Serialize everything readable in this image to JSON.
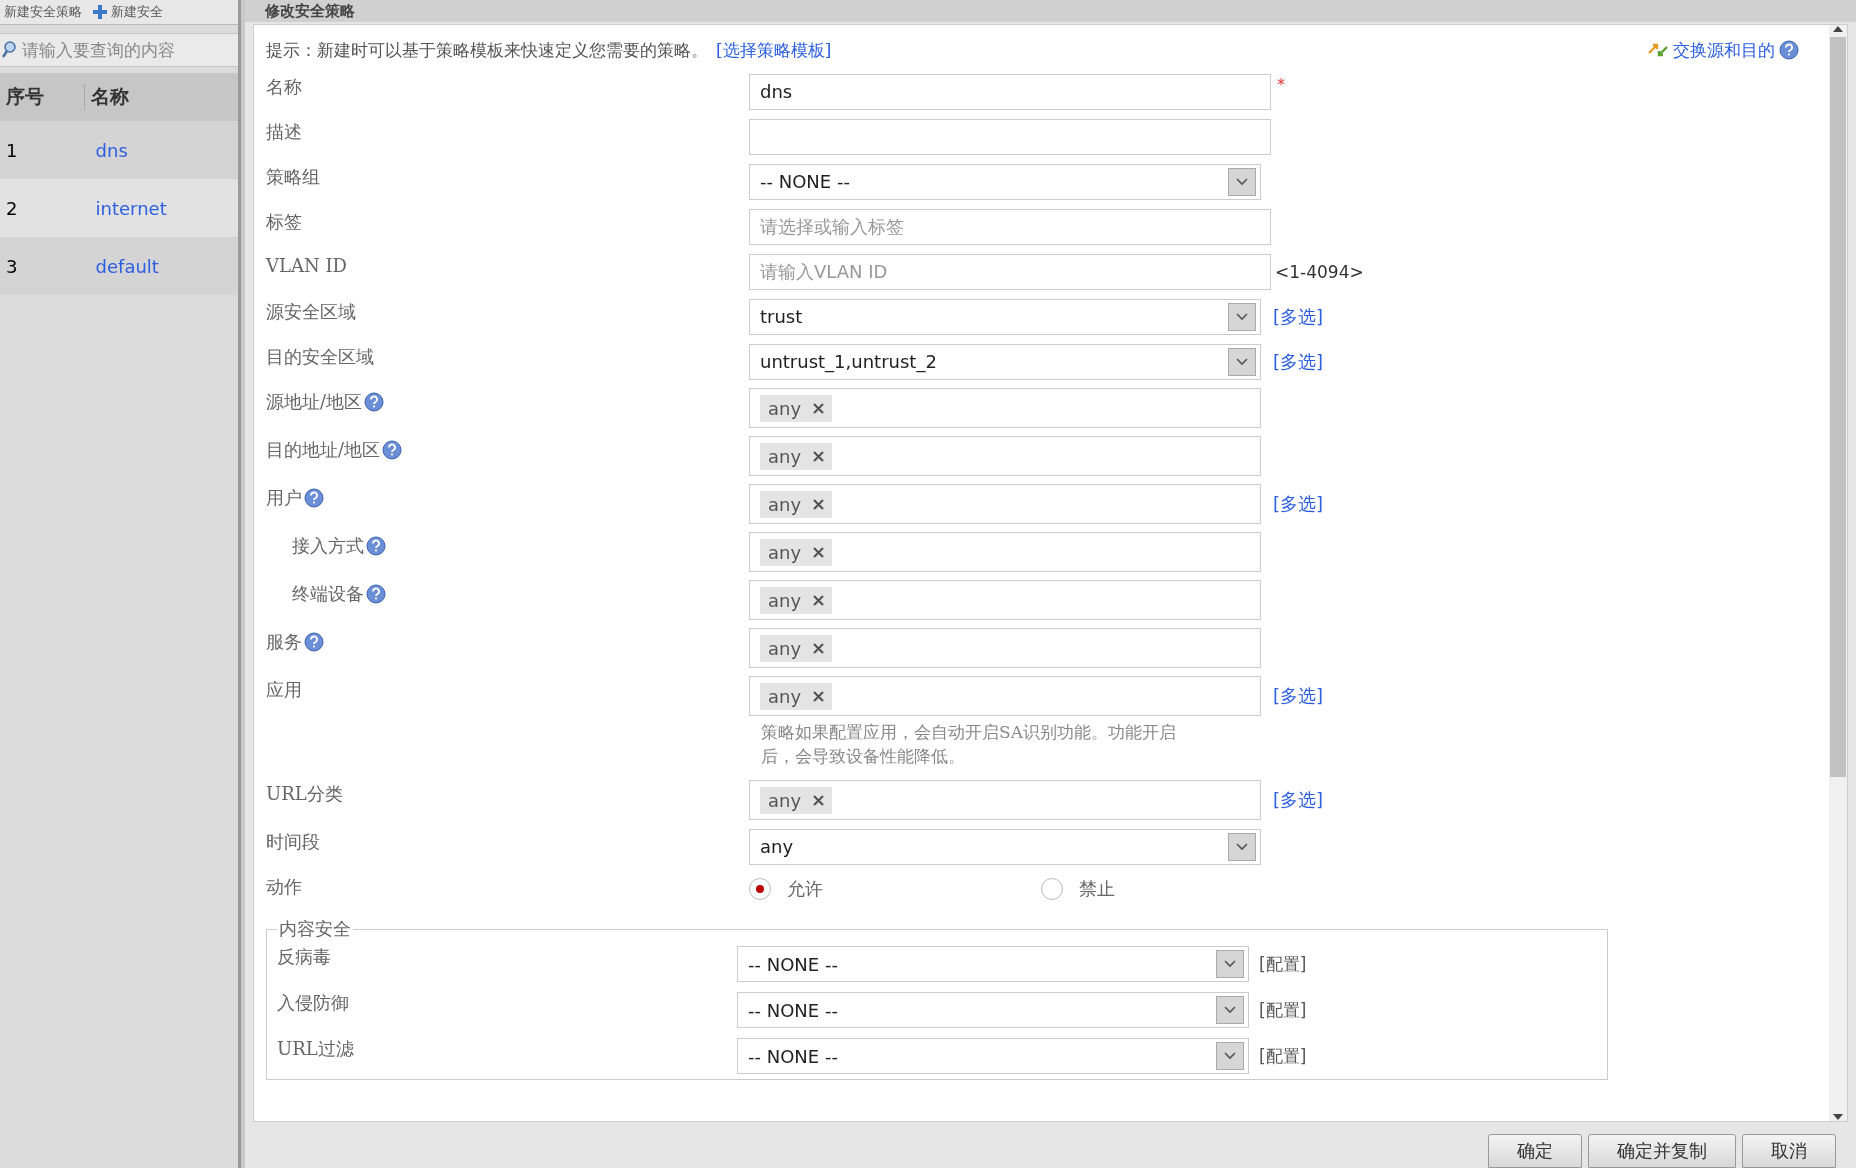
{
  "toolbar": {
    "buttons": [
      {
        "label": "新建安全策略",
        "icon": false
      },
      {
        "label": "新建安全",
        "icon": true
      }
    ]
  },
  "search": {
    "placeholder": "请输入要查询的内容"
  },
  "table": {
    "columns": [
      "序号",
      "名称"
    ],
    "rows": [
      {
        "index": "1",
        "name": "dns"
      },
      {
        "index": "2",
        "name": "internet"
      },
      {
        "index": "3",
        "name": "default"
      }
    ]
  },
  "dialog": {
    "title": "修改安全策略",
    "hint": {
      "text": "提示：新建时可以基于策略模板来快速定义您需要的策略。",
      "link": "[选择策略模板]"
    },
    "swap_link": "交换源和目的",
    "fields": [
      {
        "label": "名称",
        "kind": "text",
        "value": "dns",
        "required_mark": "*"
      },
      {
        "label": "描述",
        "kind": "text"
      },
      {
        "label": "策略组",
        "kind": "select",
        "value": "-- NONE --"
      },
      {
        "label": "标签",
        "kind": "text",
        "placeholder": "请选择或输入标签"
      },
      {
        "label": "VLAN ID",
        "kind": "text",
        "placeholder": "请输入VLAN ID",
        "suffix": "<1-4094>"
      },
      {
        "label": "源安全区域",
        "kind": "select",
        "value": "trust",
        "link": "[多选]"
      },
      {
        "label": "目的安全区域",
        "kind": "select",
        "value": "untrust_1,untrust_2",
        "link": "[多选]"
      },
      {
        "label": "源地址/地区",
        "kind": "tags",
        "tags": [
          "any"
        ],
        "help": true
      },
      {
        "label": "目的地址/地区",
        "kind": "tags",
        "tags": [
          "any"
        ],
        "help": true
      },
      {
        "label": "用户",
        "kind": "tags",
        "tags": [
          "any"
        ],
        "help": true,
        "link": "[多选]"
      },
      {
        "label": "接入方式",
        "kind": "tags",
        "tags": [
          "any"
        ],
        "help": true,
        "indented": true
      },
      {
        "label": "终端设备",
        "kind": "tags",
        "tags": [
          "any"
        ],
        "help": true,
        "indented": true
      },
      {
        "label": "服务",
        "kind": "tags",
        "tags": [
          "any"
        ],
        "help": true
      },
      {
        "label": "应用",
        "kind": "tags",
        "tags": [
          "any"
        ],
        "link": "[多选]",
        "note": "策略如果配置应用，会自动开启SA识别功能。功能开启后，会导致设备性能降低。"
      },
      {
        "label": "URL分类",
        "kind": "tags",
        "tags": [
          "any"
        ],
        "link": "[多选]"
      },
      {
        "label": "时间段",
        "kind": "select",
        "value": "any"
      }
    ],
    "action": {
      "label": "动作",
      "options": [
        {
          "label": "允许",
          "selected": true
        },
        {
          "label": "禁止",
          "selected": false
        }
      ]
    },
    "content_security": {
      "legend": "内容安全",
      "rows": [
        {
          "label": "反病毒",
          "value": "-- NONE --",
          "link": "[配置]"
        },
        {
          "label": "入侵防御",
          "value": "-- NONE --",
          "link": "[配置]"
        },
        {
          "label": "URL过滤",
          "value": "-- NONE --",
          "link": "[配置]"
        }
      ]
    },
    "buttons": [
      "确定",
      "确定并复制",
      "取消"
    ]
  }
}
